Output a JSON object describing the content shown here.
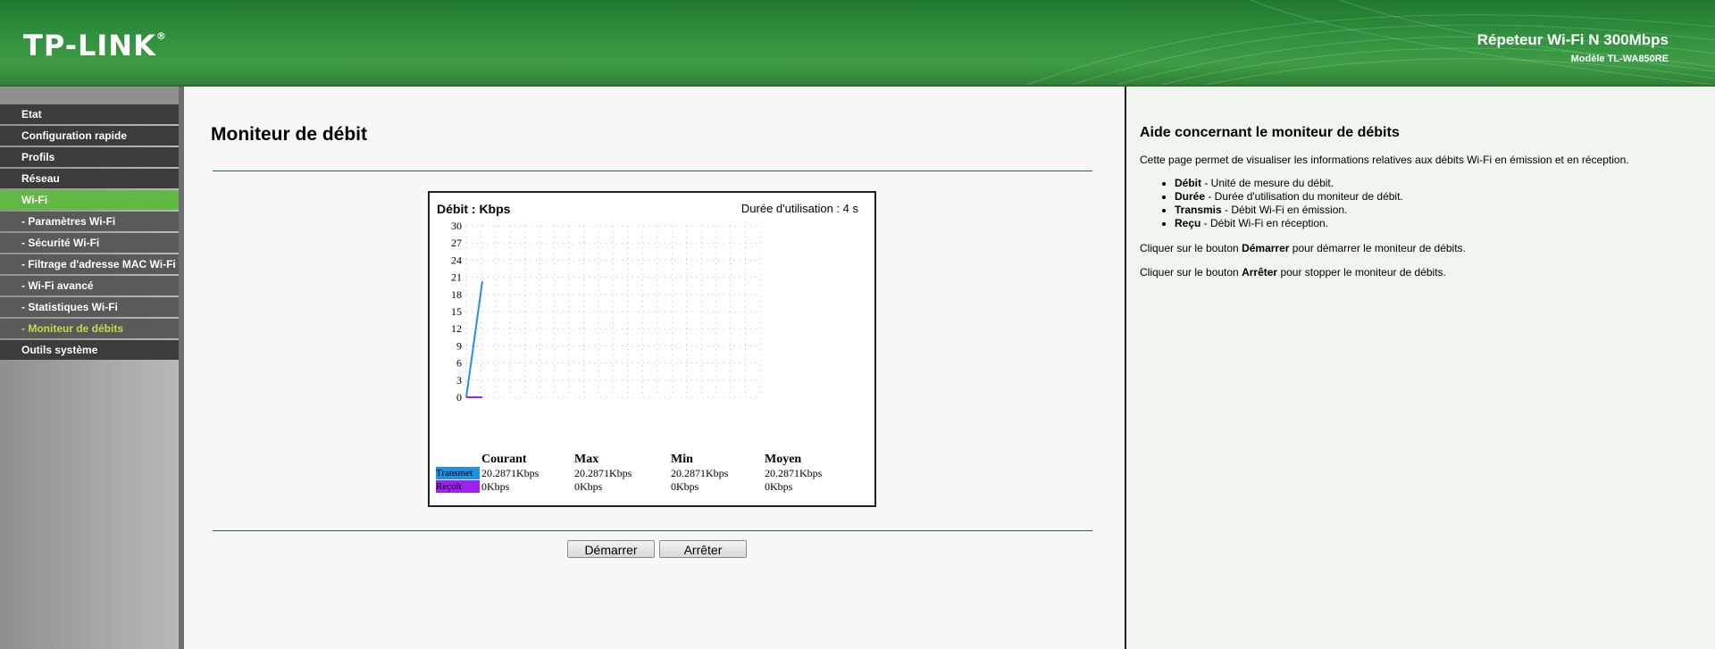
{
  "header": {
    "logo_text": "TP-LINK",
    "logo_mark": "®",
    "product_title": "Répeteur Wi-Fi N 300Mbps",
    "model": "Modèle TL-WA850RE",
    "colors": {
      "header_green": "#2f8f3e",
      "menu_active": "#62b845",
      "submenu_active_text": "#b8e04c"
    }
  },
  "sidebar": {
    "items": [
      {
        "label": "Etat",
        "type": "main"
      },
      {
        "label": "Configuration rapide",
        "type": "main"
      },
      {
        "label": "Profils",
        "type": "main"
      },
      {
        "label": "Réseau",
        "type": "main"
      },
      {
        "label": "Wi-Fi",
        "type": "active"
      },
      {
        "label": "- Paramètres Wi-Fi",
        "type": "sub"
      },
      {
        "label": "- Sécurité Wi-Fi",
        "type": "sub"
      },
      {
        "label": "- Filtrage d'adresse MAC Wi-Fi",
        "type": "sub"
      },
      {
        "label": "- Wi-Fi avancé",
        "type": "sub"
      },
      {
        "label": "- Statistiques Wi-Fi",
        "type": "sub"
      },
      {
        "label": "- Moniteur de débits",
        "type": "sub-active"
      },
      {
        "label": "Outils système",
        "type": "main"
      }
    ]
  },
  "main": {
    "title": "Moniteur de débit",
    "chart_unit": "Débit : Kbps",
    "duration": "Durée d'utilisation : 4 s",
    "stats": {
      "headers": [
        "Courant",
        "Max",
        "Min",
        "Moyen"
      ],
      "rows": [
        {
          "label": "Transmet",
          "color": "#1e90e6",
          "values": [
            "20.2871Kbps",
            "20.2871Kbps",
            "20.2871Kbps",
            "20.2871Kbps"
          ]
        },
        {
          "label": "Reçoit",
          "color": "#a020f0",
          "values": [
            "0Kbps",
            "0Kbps",
            "0Kbps",
            "0Kbps"
          ]
        }
      ]
    },
    "buttons": {
      "start": "Démarrer",
      "stop": "Arrêter"
    }
  },
  "chart_data": {
    "type": "line",
    "ylim": [
      0,
      30
    ],
    "yticks": [
      0,
      3,
      6,
      9,
      12,
      15,
      18,
      21,
      24,
      27,
      30
    ],
    "x": [
      0,
      1
    ],
    "series": [
      {
        "name": "Transmet",
        "color": "#1e90e6",
        "values": [
          0,
          20.2871
        ]
      },
      {
        "name": "Reçoit",
        "color": "#a020f0",
        "values": [
          0,
          0
        ]
      }
    ],
    "grid": true
  },
  "help": {
    "title": "Aide concernant le moniteur de débits",
    "intro": "Cette page permet de visualiser les informations relatives aux débits Wi-Fi en émission et en réception.",
    "items": [
      {
        "term": "Débit",
        "desc": " - Unité de mesure du débit."
      },
      {
        "term": "Durée",
        "desc": " - Durée d'utilisation du moniteur de débit."
      },
      {
        "term": "Transmis",
        "desc": " - Débit Wi-Fi en émission."
      },
      {
        "term": "Reçu",
        "desc": " - Débit Wi-Fi en réception."
      }
    ],
    "start_line": {
      "before": "Cliquer sur le bouton ",
      "bold": "Démarrer",
      "after": " pour démarrer le moniteur de débits."
    },
    "stop_line": {
      "before": "Cliquer sur le bouton ",
      "bold": "Arrêter",
      "after": " pour stopper le moniteur de débits."
    }
  }
}
